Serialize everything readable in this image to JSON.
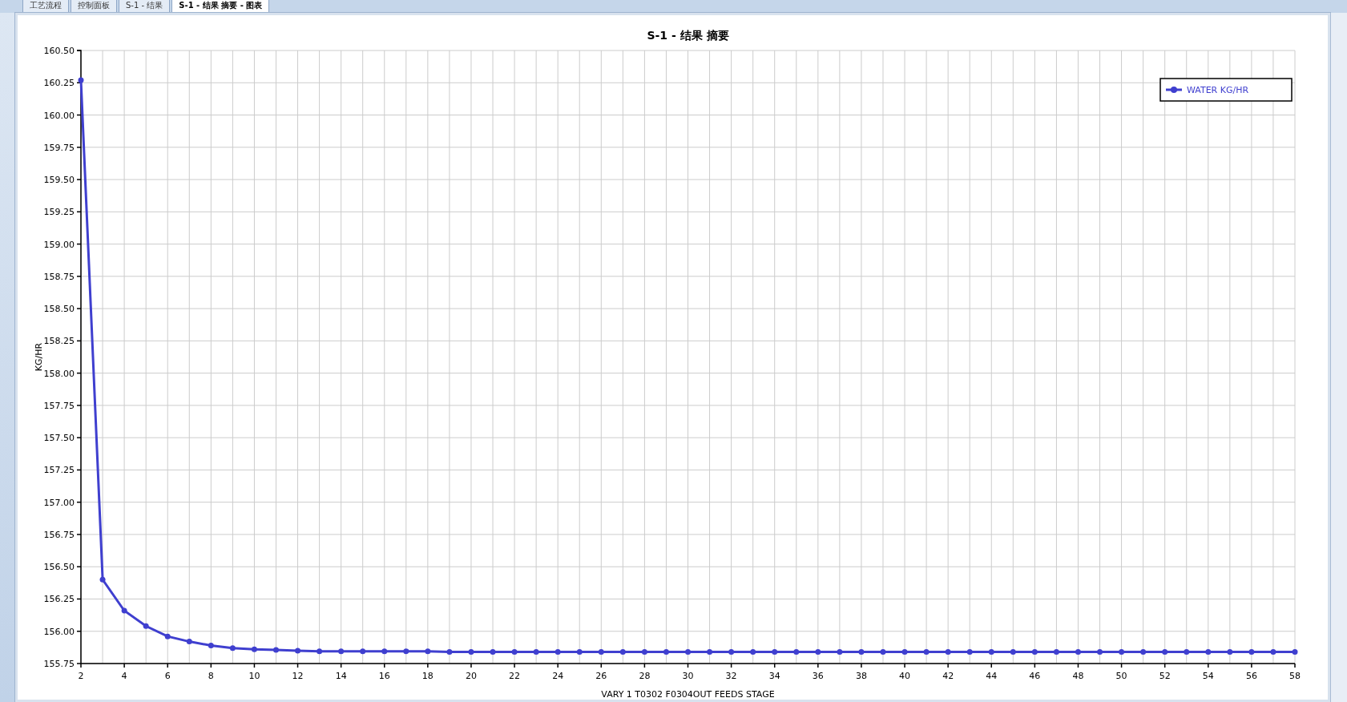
{
  "tabs": [
    {
      "label": "工艺流程",
      "selected": false
    },
    {
      "label": "控制面板",
      "selected": false
    },
    {
      "label": "S-1 - 结果",
      "selected": false
    },
    {
      "label": "S-1 - 结果 摘要 - 图表",
      "selected": true
    }
  ],
  "chart": {
    "chart_data": {
      "type": "line",
      "title": "S-1 - 结果 摘要",
      "xlabel": "VARY   1 T0302    F0304OUT FEEDS    STAGE",
      "ylabel": "KG/HR",
      "x": [
        2,
        3,
        4,
        5,
        6,
        7,
        8,
        9,
        10,
        11,
        12,
        13,
        14,
        15,
        16,
        17,
        18,
        19,
        20,
        21,
        22,
        23,
        24,
        25,
        26,
        27,
        28,
        29,
        30,
        31,
        32,
        33,
        34,
        35,
        36,
        37,
        38,
        39,
        40,
        41,
        42,
        43,
        44,
        45,
        46,
        47,
        48,
        49,
        50,
        51,
        52,
        53,
        54,
        55,
        56,
        57,
        58
      ],
      "series": [
        {
          "name": "WATER        KG/HR",
          "color": "#3f3fcf",
          "marker": "circle",
          "values": [
            160.27,
            156.4,
            156.16,
            156.04,
            155.96,
            155.92,
            155.89,
            155.87,
            155.86,
            155.855,
            155.85,
            155.845,
            155.845,
            155.845,
            155.845,
            155.845,
            155.845,
            155.84,
            155.84,
            155.84,
            155.84,
            155.84,
            155.84,
            155.84,
            155.84,
            155.84,
            155.84,
            155.84,
            155.84,
            155.84,
            155.84,
            155.84,
            155.84,
            155.84,
            155.84,
            155.84,
            155.84,
            155.84,
            155.84,
            155.84,
            155.84,
            155.84,
            155.84,
            155.84,
            155.84,
            155.84,
            155.84,
            155.84,
            155.84,
            155.84,
            155.84,
            155.84,
            155.84,
            155.84,
            155.84,
            155.84,
            155.84
          ]
        }
      ],
      "grid": true,
      "xlim": [
        2,
        58
      ],
      "ylim": [
        155.75,
        160.5
      ],
      "xticks": [
        2,
        4,
        6,
        8,
        10,
        12,
        14,
        16,
        18,
        20,
        22,
        24,
        26,
        28,
        30,
        32,
        34,
        36,
        38,
        40,
        42,
        44,
        46,
        48,
        50,
        52,
        54,
        56,
        58
      ],
      "yticks": [
        {
          "value": 155.75,
          "label": "155.75"
        },
        {
          "value": 156,
          "label": "156.00"
        },
        {
          "value": 156.25,
          "label": "156.25"
        },
        {
          "value": 156.5,
          "label": "156.50"
        },
        {
          "value": 156.75,
          "label": "156.75"
        },
        {
          "value": 157,
          "label": "157.00"
        },
        {
          "value": 157.25,
          "label": "157.25"
        },
        {
          "value": 157.5,
          "label": "157.50"
        },
        {
          "value": 157.75,
          "label": "157.75"
        },
        {
          "value": 158,
          "label": "158.00"
        },
        {
          "value": 158.25,
          "label": "158.25"
        },
        {
          "value": 158.5,
          "label": "158.50"
        },
        {
          "value": 158.75,
          "label": "158.75"
        },
        {
          "value": 159,
          "label": "159.00"
        },
        {
          "value": 159.25,
          "label": "159.25"
        },
        {
          "value": 159.5,
          "label": "159.50"
        },
        {
          "value": 159.75,
          "label": "159.75"
        },
        {
          "value": 160,
          "label": "160.00"
        },
        {
          "value": 160.25,
          "label": "160.25"
        },
        {
          "value": 160.5,
          "label": "160.50"
        }
      ]
    }
  }
}
